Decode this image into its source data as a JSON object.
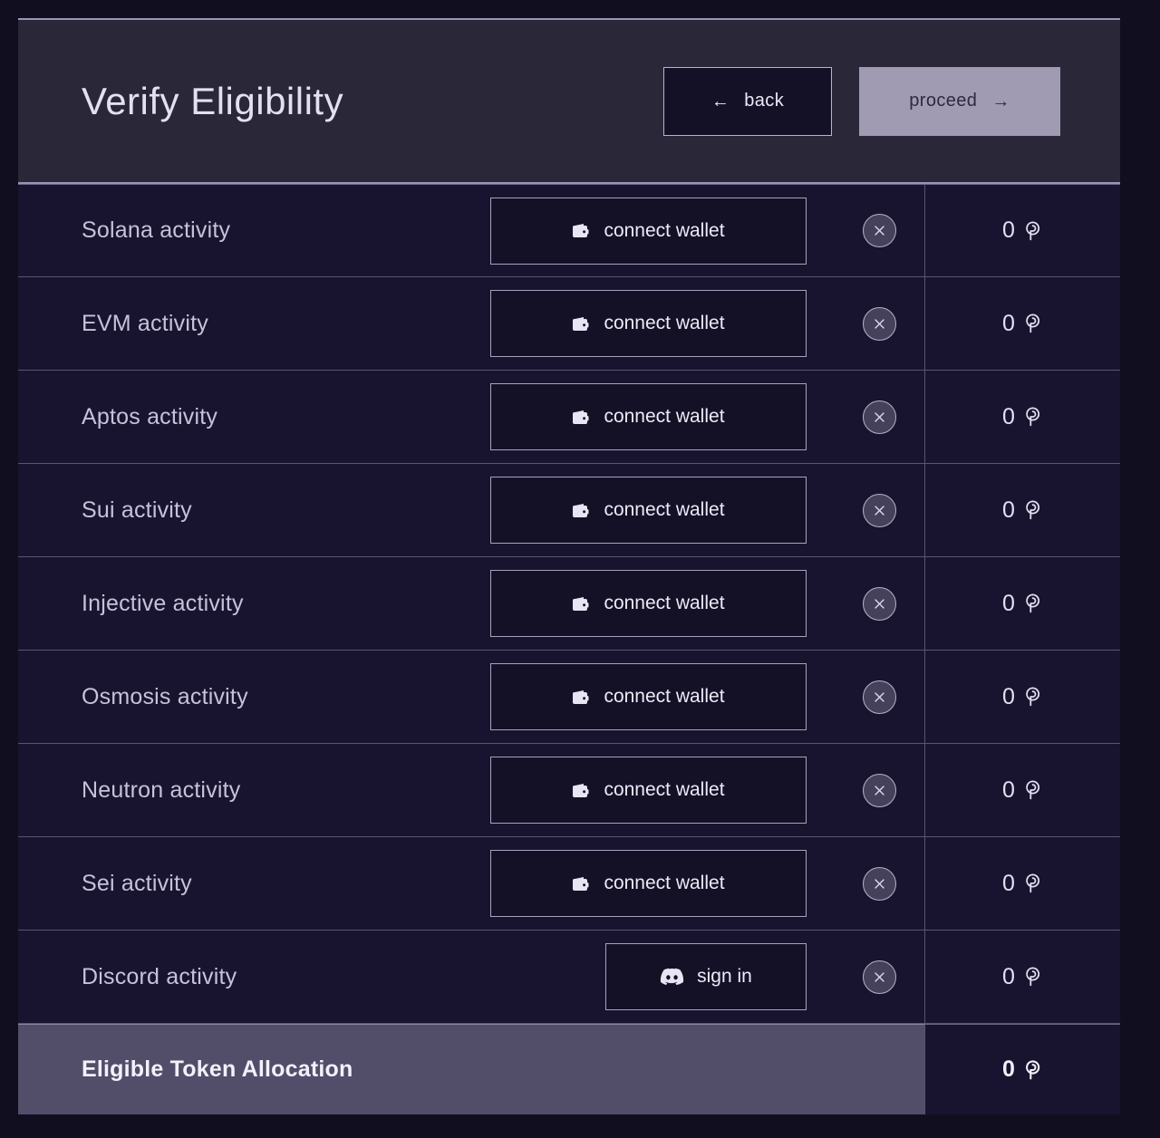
{
  "header": {
    "title": "Verify Eligibility",
    "back_label": "back",
    "back_arrow": "←",
    "proceed_label": "proceed",
    "proceed_arrow": "→"
  },
  "table": {
    "rows": [
      {
        "label": "Solana activity",
        "action": "connect wallet",
        "action_icon": "wallet-icon",
        "clear_icon": "close-icon",
        "amount": "0",
        "token": "pyth-logo"
      },
      {
        "label": "EVM activity",
        "action": "connect wallet",
        "action_icon": "wallet-icon",
        "clear_icon": "close-icon",
        "amount": "0",
        "token": "pyth-logo"
      },
      {
        "label": "Aptos activity",
        "action": "connect wallet",
        "action_icon": "wallet-icon",
        "clear_icon": "close-icon",
        "amount": "0",
        "token": "pyth-logo"
      },
      {
        "label": "Sui activity",
        "action": "connect wallet",
        "action_icon": "wallet-icon",
        "clear_icon": "close-icon",
        "amount": "0",
        "token": "pyth-logo"
      },
      {
        "label": "Injective activity",
        "action": "connect wallet",
        "action_icon": "wallet-icon",
        "clear_icon": "close-icon",
        "amount": "0",
        "token": "pyth-logo"
      },
      {
        "label": "Osmosis activity",
        "action": "connect wallet",
        "action_icon": "wallet-icon",
        "clear_icon": "close-icon",
        "amount": "0",
        "token": "pyth-logo"
      },
      {
        "label": "Neutron activity",
        "action": "connect wallet",
        "action_icon": "wallet-icon",
        "clear_icon": "close-icon",
        "amount": "0",
        "token": "pyth-logo"
      },
      {
        "label": "Sei activity",
        "action": "connect wallet",
        "action_icon": "wallet-icon",
        "clear_icon": "close-icon",
        "amount": "0",
        "token": "pyth-logo"
      },
      {
        "label": "Discord activity",
        "action": "sign in",
        "action_icon": "discord-icon",
        "clear_icon": "close-icon",
        "amount": "0",
        "token": "pyth-logo"
      }
    ],
    "total": {
      "label": "Eligible Token Allocation",
      "amount": "0",
      "token": "pyth-logo"
    }
  },
  "colors": {
    "page_background": "#110e1f",
    "header_background": "#2a2739",
    "row_background": "#181430",
    "total_background": "#524d69",
    "accent_button": "#a09bb3",
    "border": "#5a5470",
    "text": "#c6c2d8"
  }
}
